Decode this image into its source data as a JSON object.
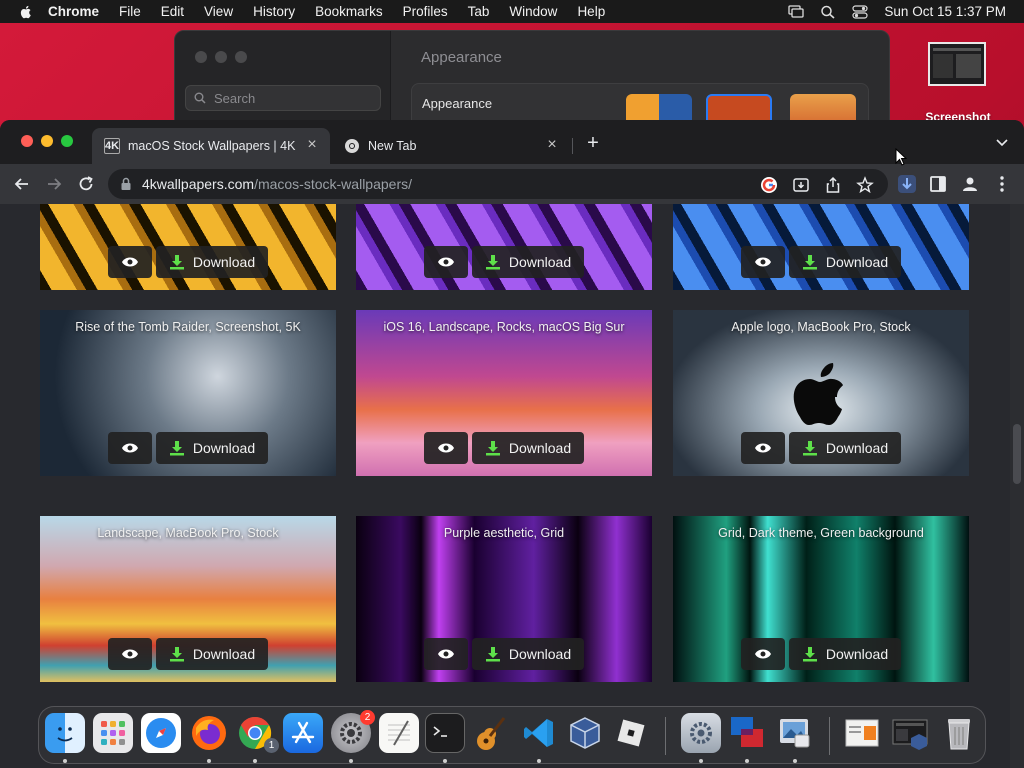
{
  "menubar": {
    "app": "Chrome",
    "items": [
      "File",
      "Edit",
      "View",
      "History",
      "Bookmarks",
      "Profiles",
      "Tab",
      "Window",
      "Help"
    ],
    "clock": "Sun Oct 15  1:37 PM"
  },
  "settings": {
    "search_placeholder": "Search",
    "title": "Appearance",
    "panel_label": "Appearance"
  },
  "desktop_icon": {
    "label": "Screenshot"
  },
  "tabs": [
    {
      "title": "macOS Stock Wallpapers | 4K",
      "favicon": "4K"
    },
    {
      "title": "New Tab"
    }
  ],
  "omnibox": {
    "host": "4kwallpapers.com",
    "path": "/macos-stock-wallpapers/"
  },
  "cards": [
    {
      "caption": "",
      "download": "Download"
    },
    {
      "caption": "",
      "download": "Download"
    },
    {
      "caption": "",
      "download": "Download"
    },
    {
      "caption": "Rise of the Tomb Raider, Screenshot, 5K",
      "download": "Download"
    },
    {
      "caption": "iOS 16, Landscape, Rocks, macOS Big Sur",
      "download": "Download"
    },
    {
      "caption": "Apple logo, MacBook Pro, Stock",
      "download": "Download"
    },
    {
      "caption": "Landscape, MacBook Pro, Stock",
      "download": "Download"
    },
    {
      "caption": "Purple aesthetic, Grid",
      "download": "Download"
    },
    {
      "caption": "Grid, Dark theme, Green background",
      "download": "Download"
    }
  ],
  "dock": {
    "settings_badge": "2",
    "chrome_badge": "1"
  },
  "colors": {
    "download_icon": "#5ee04a",
    "accent": "#1a73e8"
  }
}
